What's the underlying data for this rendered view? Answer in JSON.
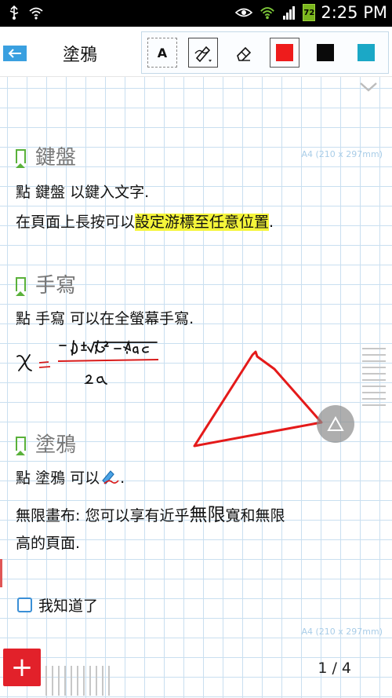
{
  "status": {
    "battery": "72",
    "time": "2:25 PM"
  },
  "toolbar": {
    "title": "塗鴉",
    "text_tool_label": "A",
    "colors": {
      "red": "#ee1c1c",
      "black": "#0a0a0a",
      "teal": "#1ba8c6"
    }
  },
  "paper": {
    "size_label": "A4 (210 x 297mm)",
    "size_label_bottom": "A4 (210 x 297mm)"
  },
  "sections": {
    "keyboard": {
      "title": "鍵盤",
      "line1": "點 鍵盤 以鍵入文字.",
      "line2_plain": "在頁面上長按可以",
      "line2_highlight": "設定游標至任意位置",
      "line2_end": "."
    },
    "handwriting": {
      "title": "手寫",
      "line1": "點 手寫 可以在全螢幕手寫."
    },
    "doodle": {
      "title": "塗鴉",
      "line1_start": "點 塗鴉 可以",
      "line1_end": ".",
      "line2_a": "無限畫布: 您可以享有近乎",
      "line2_big": "無限",
      "line2_b": "寬和無限",
      "line3": "高的頁面."
    }
  },
  "checkbox_label": "我知道了",
  "fab_label": "+",
  "page_indicator": "1 / 4"
}
